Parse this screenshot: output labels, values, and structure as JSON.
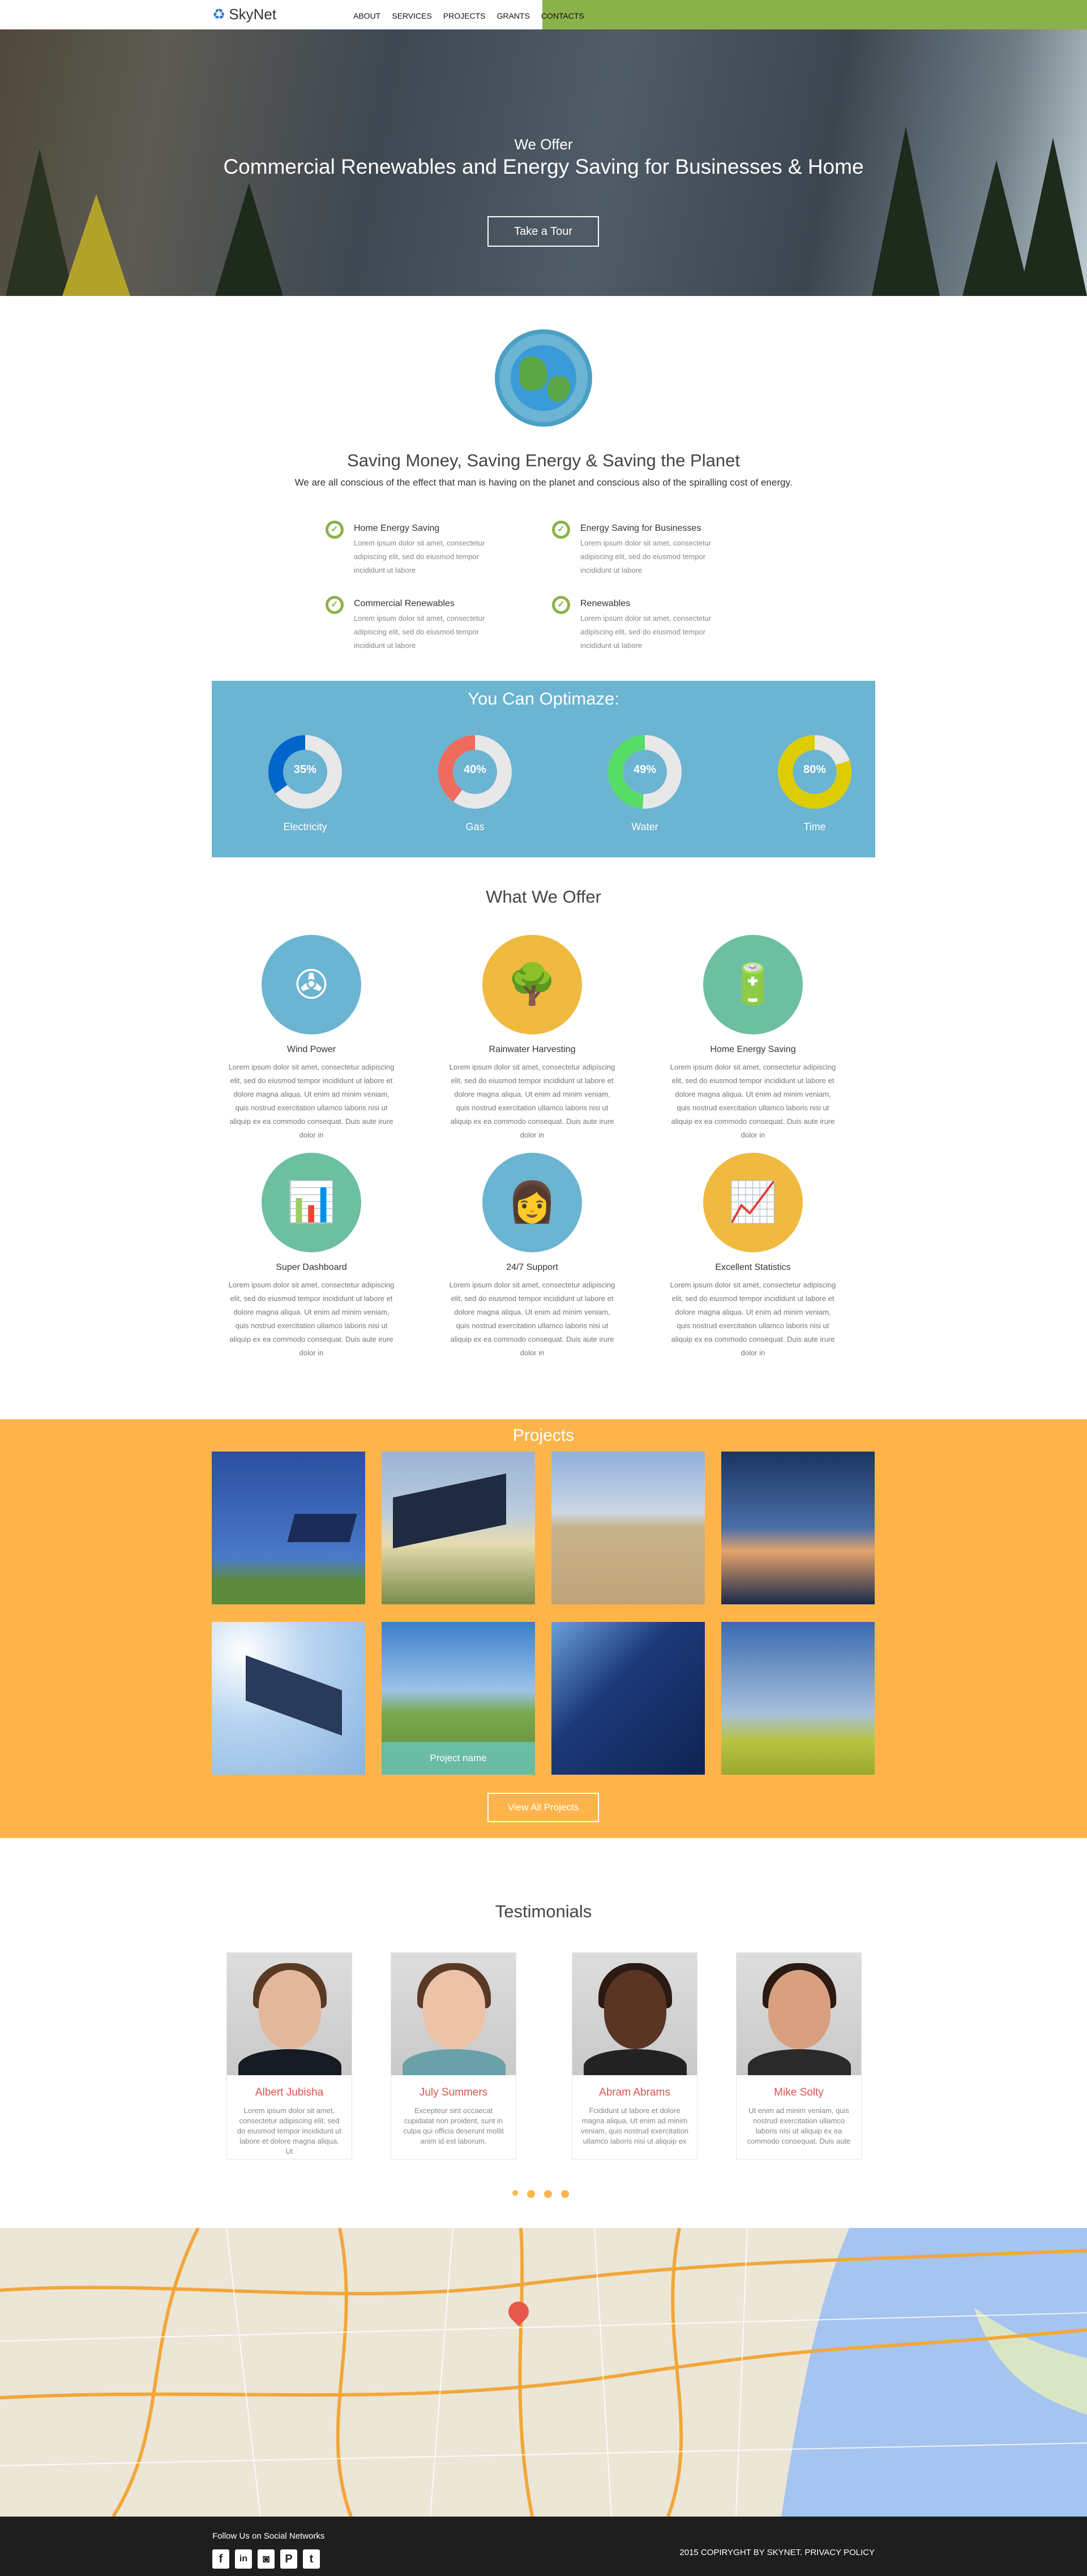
{
  "nav": {
    "logo": "SkyNet",
    "items": [
      "ABOUT",
      "SERVICES",
      "PROJECTS",
      "GRANTS",
      "CONTACTS"
    ],
    "active": "ABOUT",
    "accent": "#8bb24a"
  },
  "hero": {
    "kicker": "We Offer",
    "title": "Commercial Renewables and Energy Saving for Businesses & Home",
    "cta": "Take a Tour"
  },
  "intro": {
    "icon": "globe-icon",
    "title": "Saving Money, Saving Energy & Saving the Planet",
    "subtitle": "We are all conscious of the effect that man is having on the planet and conscious also of the spiralling cost of energy."
  },
  "features": [
    {
      "title": "Home Energy Saving",
      "text": "Lorem ipsum dolor sit amet, consectetur adipiscing elit, sed do eiusmod tempor incididunt ut labore"
    },
    {
      "title": "Energy Saving for Businesses",
      "text": "Lorem ipsum dolor sit amet, consectetur adipiscing elit, sed do eiusmod tempor incididunt ut labore"
    },
    {
      "title": "Commercial Renewables",
      "text": "Lorem ipsum dolor sit amet, consectetur adipiscing elit, sed do eiusmod tempor incididunt ut labore"
    },
    {
      "title": "Renewables",
      "text": "Lorem ipsum dolor sit amet, consectetur adipiscing elit, sed do eiusmod tempor incididunt ut labore"
    }
  ],
  "optimize": {
    "title": "You Can Optimaze:",
    "bg": "#6bb4d2",
    "items": [
      {
        "label": "Electricity",
        "value": 35,
        "text": "35%",
        "color": "#0066cc"
      },
      {
        "label": "Gas",
        "value": 40,
        "text": "40%",
        "color": "#ee6b5e"
      },
      {
        "label": "Water",
        "value": 49,
        "text": "49%",
        "color": "#55dd66"
      },
      {
        "label": "Time",
        "value": 80,
        "text": "80%",
        "color": "#ddcc00"
      }
    ]
  },
  "offer": {
    "title": "What We Offer",
    "items": [
      {
        "title": "Wind Power",
        "icon": "wind-turbine-icon",
        "color": "#6bb4d2",
        "text": "Lorem ipsum dolor sit amet, consectetur adipiscing elit, sed do eiusmod tempor incididunt ut labore et dolore magna aliqua. Ut enim ad minim veniam, quis nostrud exercitation ullamco laboris nisi ut aliquip ex ea commodo consequat. Duis aute irure dolor in"
      },
      {
        "title": "Rainwater Harvesting",
        "icon": "bonsai-tree-icon",
        "color": "#f0b93f",
        "text": "Lorem ipsum dolor sit amet, consectetur adipiscing elit, sed do eiusmod tempor incididunt ut labore et dolore magna aliqua. Ut enim ad minim veniam, quis nostrud exercitation ullamco laboris nisi ut aliquip ex ea commodo consequat. Duis aute irure dolor in"
      },
      {
        "title": "Home Energy Saving",
        "icon": "battery-icon",
        "color": "#6cbfa0",
        "text": "Lorem ipsum dolor sit amet, consectetur adipiscing elit, sed do eiusmod tempor incididunt ut labore et dolore magna aliqua. Ut enim ad minim veniam, quis nostrud exercitation ullamco laboris nisi ut aliquip ex ea commodo consequat. Duis aute irure dolor in"
      },
      {
        "title": "Super Dashboard",
        "icon": "tablet-chart-icon",
        "color": "#6cbfa0",
        "text": "Lorem ipsum dolor sit amet, consectetur adipiscing elit, sed do eiusmod tempor incididunt ut labore et dolore magna aliqua. Ut enim ad minim veniam, quis nostrud exercitation ullamco laboris nisi ut aliquip ex ea commodo consequat. Duis aute irure dolor in"
      },
      {
        "title": "24/7 Support",
        "icon": "support-agent-icon",
        "color": "#6bb4d2",
        "text": "Lorem ipsum dolor sit amet, consectetur adipiscing elit, sed do eiusmod tempor incididunt ut labore et dolore magna aliqua. Ut enim ad minim veniam, quis nostrud exercitation ullamco laboris nisi ut aliquip ex ea commodo consequat. Duis aute irure dolor in"
      },
      {
        "title": "Excellent Statistics",
        "icon": "statistics-icon",
        "color": "#f0b93f",
        "text": "Lorem ipsum dolor sit amet, consectetur adipiscing elit, sed do eiusmod tempor incididunt ut labore et dolore magna aliqua. Ut enim ad minim veniam, quis nostrud exercitation ullamco laboris nisi ut aliquip ex ea commodo consequat. Duis aute irure dolor in"
      }
    ]
  },
  "projects": {
    "title": "Projects",
    "bg": "#fdb54b",
    "hover_label": "Project name",
    "button": "View All Projects"
  },
  "testimonials": {
    "title": "Testimonials",
    "items": [
      {
        "name": "Albert Jubisha",
        "text": "Lorem ipsum dolor sit amet, consectetur adipiscing elit, sed do eiusmod tempor incididunt ut labore et dolore magna aliqua. Ut"
      },
      {
        "name": "July Summers",
        "text": "Excepteur sint occaecat cupidatat non proident, sunt in culpa qui officia deserunt mollit anim id est laborum."
      },
      {
        "name": "Abram Abrams",
        "text": "Fcididunt ut labore et dolore magna aliqua. Ut enim ad minim veniam, quis nostrud exercitation ullamco laboris nisi ut aliquip ex"
      },
      {
        "name": "Mike Solty",
        "text": "Ut enim ad minim veniam, quis nostrud exercitation ullamco laboris nisi ut aliquip ex ea commodo consequat. Duis aute"
      }
    ]
  },
  "footer": {
    "follow": "Follow Us on Social Networks",
    "social": [
      "facebook",
      "linkedin",
      "instagram",
      "pinterest",
      "twitter"
    ],
    "copyright": "2015 COPIRYGHT BY SKYNET. PRIVACY POLICY"
  }
}
